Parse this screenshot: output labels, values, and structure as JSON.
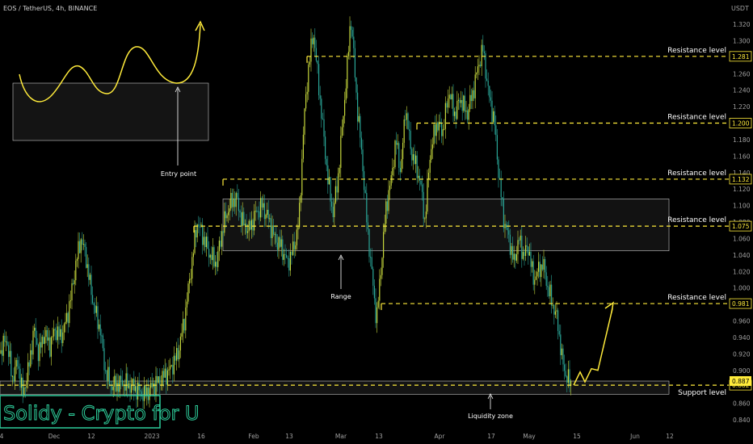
{
  "header": {
    "symbol_line": "EOS / TetherUS, 4h, BINANCE"
  },
  "chart_data": {
    "type": "candlestick",
    "currency": "USDT",
    "y_ticks": [
      "1.320",
      "1.300",
      "1.280",
      "1.260",
      "1.240",
      "1.220",
      "1.200",
      "1.180",
      "1.160",
      "1.140",
      "1.120",
      "1.100",
      "1.080",
      "1.060",
      "1.040",
      "1.020",
      "1.000",
      "0.980",
      "0.960",
      "0.940",
      "0.920",
      "0.900",
      "0.880",
      "0.860",
      "0.840"
    ],
    "x_ticks": [
      "4",
      "Dec",
      "12",
      "2023",
      "16",
      "Feb",
      "13",
      "Mar",
      "13",
      "Apr",
      "17",
      "May",
      "15",
      "Jun",
      "12"
    ],
    "price_path": [
      [
        0,
        0.92
      ],
      [
        8,
        0.94
      ],
      [
        15,
        0.89
      ],
      [
        22,
        0.91
      ],
      [
        28,
        0.87
      ],
      [
        35,
        0.9
      ],
      [
        42,
        0.95
      ],
      [
        48,
        0.92
      ],
      [
        55,
        0.945
      ],
      [
        62,
        0.93
      ],
      [
        68,
        0.95
      ],
      [
        75,
        0.94
      ],
      [
        82,
        0.96
      ],
      [
        88,
        0.99
      ],
      [
        94,
        1.03
      ],
      [
        100,
        1.06
      ],
      [
        106,
        1.04
      ],
      [
        112,
        1.0
      ],
      [
        118,
        0.97
      ],
      [
        124,
        0.95
      ],
      [
        130,
        0.9
      ],
      [
        138,
        0.88
      ],
      [
        150,
        0.885
      ],
      [
        165,
        0.88
      ],
      [
        178,
        0.87
      ],
      [
        188,
        0.88
      ],
      [
        200,
        0.89
      ],
      [
        210,
        0.9
      ],
      [
        220,
        0.92
      ],
      [
        228,
        0.96
      ],
      [
        236,
        1.02
      ],
      [
        244,
        1.08
      ],
      [
        252,
        1.06
      ],
      [
        260,
        1.04
      ],
      [
        268,
        1.03
      ],
      [
        276,
        1.075
      ],
      [
        284,
        1.1
      ],
      [
        292,
        1.11
      ],
      [
        300,
        1.08
      ],
      [
        308,
        1.07
      ],
      [
        316,
        1.09
      ],
      [
        324,
        1.1
      ],
      [
        332,
        1.085
      ],
      [
        340,
        1.06
      ],
      [
        348,
        1.05
      ],
      [
        356,
        1.03
      ],
      [
        364,
        1.05
      ],
      [
        370,
        1.08
      ],
      [
        376,
        1.2
      ],
      [
        382,
        1.27
      ],
      [
        388,
        1.31
      ],
      [
        394,
        1.25
      ],
      [
        400,
        1.19
      ],
      [
        406,
        1.13
      ],
      [
        412,
        1.09
      ],
      [
        418,
        1.13
      ],
      [
        424,
        1.2
      ],
      [
        430,
        1.27
      ],
      [
        434,
        1.33
      ],
      [
        438,
        1.28
      ],
      [
        442,
        1.22
      ],
      [
        448,
        1.16
      ],
      [
        454,
        1.08
      ],
      [
        460,
        1.02
      ],
      [
        466,
        0.96
      ],
      [
        472,
        1.03
      ],
      [
        478,
        1.1
      ],
      [
        484,
        1.13
      ],
      [
        490,
        1.18
      ],
      [
        496,
        1.14
      ],
      [
        502,
        1.22
      ],
      [
        508,
        1.17
      ],
      [
        514,
        1.15
      ],
      [
        520,
        1.13
      ],
      [
        526,
        1.08
      ],
      [
        532,
        1.16
      ],
      [
        540,
        1.2
      ],
      [
        548,
        1.19
      ],
      [
        556,
        1.24
      ],
      [
        562,
        1.21
      ],
      [
        570,
        1.23
      ],
      [
        578,
        1.21
      ],
      [
        586,
        1.24
      ],
      [
        592,
        1.27
      ],
      [
        598,
        1.29
      ],
      [
        604,
        1.24
      ],
      [
        612,
        1.2
      ],
      [
        618,
        1.13
      ],
      [
        624,
        1.08
      ],
      [
        630,
        1.06
      ],
      [
        636,
        1.03
      ],
      [
        642,
        1.06
      ],
      [
        648,
        1.04
      ],
      [
        654,
        1.05
      ],
      [
        660,
        1.01
      ],
      [
        666,
        1.02
      ],
      [
        672,
        1.03
      ],
      [
        678,
        1.0
      ],
      [
        684,
        0.98
      ],
      [
        690,
        0.96
      ],
      [
        696,
        0.91
      ],
      [
        702,
        0.89
      ],
      [
        708,
        0.882
      ]
    ],
    "resistance_levels": [
      {
        "label": "Resistance level",
        "price": 1.281,
        "price_tag": "1.281",
        "from_x": 380
      },
      {
        "label": "Resistance level",
        "price": 1.2,
        "price_tag": "1.200",
        "from_x": 516
      },
      {
        "label": "Resistance level",
        "price": 1.132,
        "price_tag": "1.132",
        "from_x": 276
      },
      {
        "label": "Resistance level",
        "price": 1.075,
        "price_tag": "1.075",
        "from_x": 240
      },
      {
        "label": "Resistance level",
        "price": 0.981,
        "price_tag": "0.981",
        "from_x": 472
      }
    ],
    "support_levels": [
      {
        "label": "Support level",
        "price": 0.882,
        "price_tag": "0.882",
        "from_x": 0
      }
    ],
    "current_price": {
      "value": 0.887,
      "tag": "0.887"
    },
    "range_zone": {
      "label": "Range",
      "top": 1.108,
      "bottom": 1.045
    },
    "liquidity_zone": {
      "label": "Liquidity zone",
      "top": 0.887,
      "bottom": 0.871
    },
    "legend_box": {
      "label": "Entry point"
    },
    "projection": {
      "points": [
        [
          710,
          0.882
        ],
        [
          718,
          0.898
        ],
        [
          724,
          0.886
        ],
        [
          732,
          0.902
        ],
        [
          740,
          0.9
        ],
        [
          758,
          0.975
        ]
      ]
    },
    "grid": false
  },
  "watermark": {
    "text": "Solidy - Crypto for U"
  },
  "colors": {
    "background": "#000000",
    "level_line": "#ffeb3b",
    "candle": "#c6d73c",
    "candle_alt": "#2aa698",
    "box": "#c8c8c8",
    "text": "#ffffff",
    "axis_text": "#a0a0a0",
    "watermark": "#2ecc9a"
  }
}
